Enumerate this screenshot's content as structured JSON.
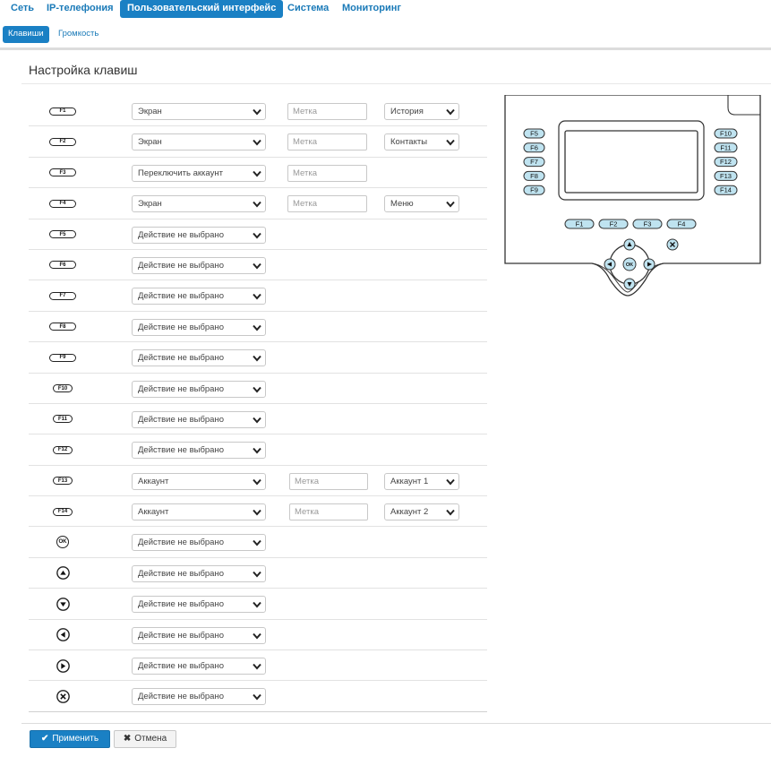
{
  "topnav": [
    {
      "label": "Сеть",
      "active": false
    },
    {
      "label": "IP-телефония",
      "active": false
    },
    {
      "label": "Пользовательский интерфейс",
      "active": true
    },
    {
      "label": "Система",
      "active": false
    },
    {
      "label": "Мониторинг",
      "active": false
    }
  ],
  "subnav": [
    {
      "label": "Клавиши",
      "active": true
    },
    {
      "label": "Громкость",
      "active": false
    }
  ],
  "page_title": "Настройка клавиш",
  "rows": [
    {
      "key": "F1",
      "shape": "pill",
      "action": "Экран",
      "label_placeholder": "Метка",
      "extra": "История"
    },
    {
      "key": "F2",
      "shape": "pill",
      "action": "Экран",
      "label_placeholder": "Метка",
      "extra": "Контакты"
    },
    {
      "key": "F3",
      "shape": "pill",
      "action": "Переключить аккаунт",
      "label_placeholder": "Метка",
      "extra": null
    },
    {
      "key": "F4",
      "shape": "pill",
      "action": "Экран",
      "label_placeholder": "Метка",
      "extra": "Меню"
    },
    {
      "key": "F5",
      "shape": "pill",
      "action": "Действие не выбрано",
      "label_placeholder": null,
      "extra": null
    },
    {
      "key": "F6",
      "shape": "pill",
      "action": "Действие не выбрано",
      "label_placeholder": null,
      "extra": null
    },
    {
      "key": "F7",
      "shape": "pill",
      "action": "Действие не выбрано",
      "label_placeholder": null,
      "extra": null
    },
    {
      "key": "F8",
      "shape": "pill",
      "action": "Действие не выбрано",
      "label_placeholder": null,
      "extra": null
    },
    {
      "key": "F9",
      "shape": "pill",
      "action": "Действие не выбрано",
      "label_placeholder": null,
      "extra": null
    },
    {
      "key": "F10",
      "shape": "pill",
      "action": "Действие не выбрано",
      "label_placeholder": null,
      "extra": null
    },
    {
      "key": "F11",
      "shape": "pill",
      "action": "Действие не выбрано",
      "label_placeholder": null,
      "extra": null
    },
    {
      "key": "F12",
      "shape": "pill",
      "action": "Действие не выбрано",
      "label_placeholder": null,
      "extra": null
    },
    {
      "key": "F13",
      "shape": "pill",
      "action": "Аккаунт",
      "label_placeholder": "Метка",
      "extra": "Аккаунт 1"
    },
    {
      "key": "F14",
      "shape": "pill",
      "action": "Аккаунт",
      "label_placeholder": "Метка",
      "extra": "Аккаунт 2"
    },
    {
      "key": "OK",
      "shape": "ok",
      "action": "Действие не выбрано",
      "label_placeholder": null,
      "extra": null
    },
    {
      "key": "",
      "shape": "up",
      "action": "Действие не выбрано",
      "label_placeholder": null,
      "extra": null
    },
    {
      "key": "",
      "shape": "down",
      "action": "Действие не выбрано",
      "label_placeholder": null,
      "extra": null
    },
    {
      "key": "",
      "shape": "left",
      "action": "Действие не выбрано",
      "label_placeholder": null,
      "extra": null
    },
    {
      "key": "",
      "shape": "right",
      "action": "Действие не выбрано",
      "label_placeholder": null,
      "extra": null
    },
    {
      "key": "",
      "shape": "cancel",
      "action": "Действие не выбрано",
      "label_placeholder": null,
      "extra": null
    }
  ],
  "phone": {
    "left_keys": [
      "F5",
      "F6",
      "F7",
      "F8",
      "F9"
    ],
    "right_keys": [
      "F10",
      "F11",
      "F12",
      "F13",
      "F14"
    ],
    "bottom_keys": [
      "F1",
      "F2",
      "F3",
      "F4"
    ],
    "ok_label": "OK",
    "key_fill": "#bfe3f0"
  },
  "buttons": {
    "apply": "Применить",
    "cancel": "Отмена"
  },
  "colors": {
    "accent": "#1a80c4"
  }
}
